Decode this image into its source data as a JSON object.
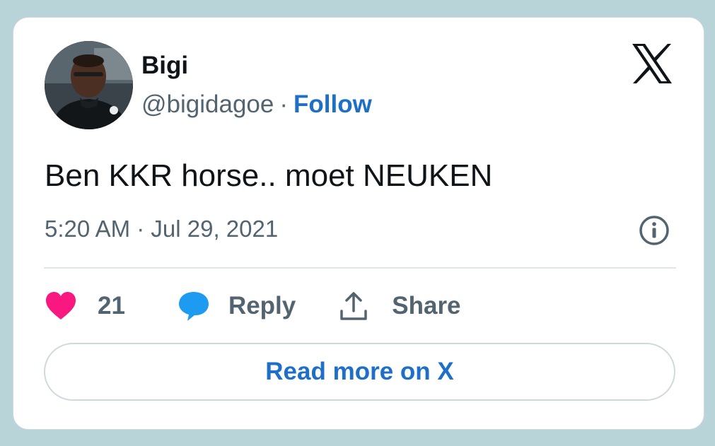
{
  "author": {
    "name": "Bigi",
    "handle": "@bigidagoe",
    "separator": "·",
    "follow_label": "Follow",
    "avatar_icon": "profile-photo"
  },
  "brand": {
    "logo_icon": "x-logo-icon"
  },
  "tweet": {
    "text": "Ben KKR horse.. moet NEUKEN",
    "timestamp": "5:20 AM · Jul 29, 2021"
  },
  "actions": {
    "like_count": "21",
    "reply_label": "Reply",
    "share_label": "Share"
  },
  "footer": {
    "read_more_label": "Read more on X"
  },
  "colors": {
    "background": "#b8d4d9",
    "card": "#ffffff",
    "link_blue": "#1d6fc7",
    "like_pink": "#f91880",
    "reply_blue": "#1d9bf0",
    "secondary_text": "#536471",
    "border": "#cfd9de"
  }
}
